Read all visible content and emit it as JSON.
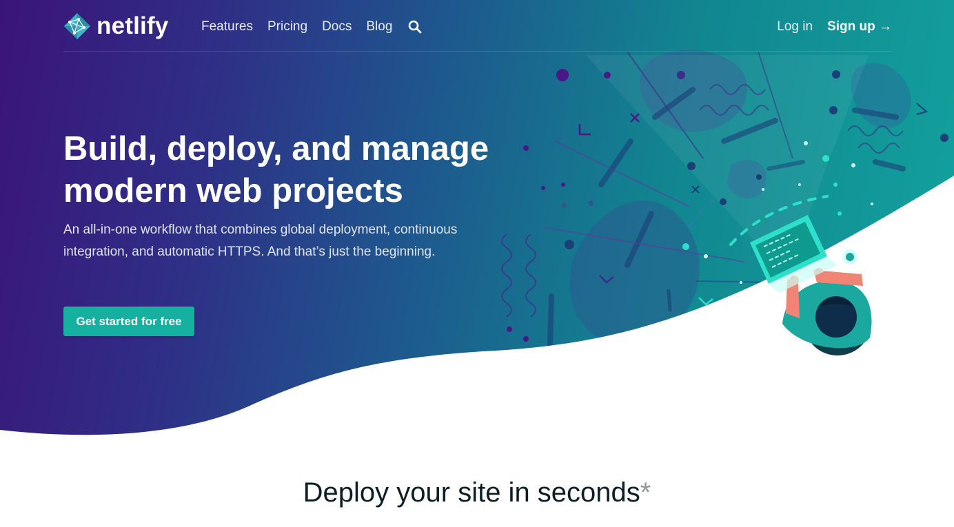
{
  "brand": {
    "name": "netlify"
  },
  "nav": {
    "links": [
      {
        "label": "Features"
      },
      {
        "label": "Pricing"
      },
      {
        "label": "Docs"
      },
      {
        "label": "Blog"
      }
    ],
    "login": "Log in",
    "signup": "Sign up →",
    "search_icon": "search-icon"
  },
  "hero": {
    "headline": "Build, deploy, and manage modern web projects",
    "subtext": "An all-in-one workflow that combines global deployment, continuous integration, and automatic HTTPS. And that’s just the beginning.",
    "cta_label": "Get started for free"
  },
  "section": {
    "title": "Deploy your site in seconds",
    "title_mark": "*"
  },
  "colors": {
    "gradient_start": "#3b1479",
    "gradient_end": "#13a39e",
    "cta": "#15b0a0",
    "heading_dark": "#0e1e25"
  }
}
